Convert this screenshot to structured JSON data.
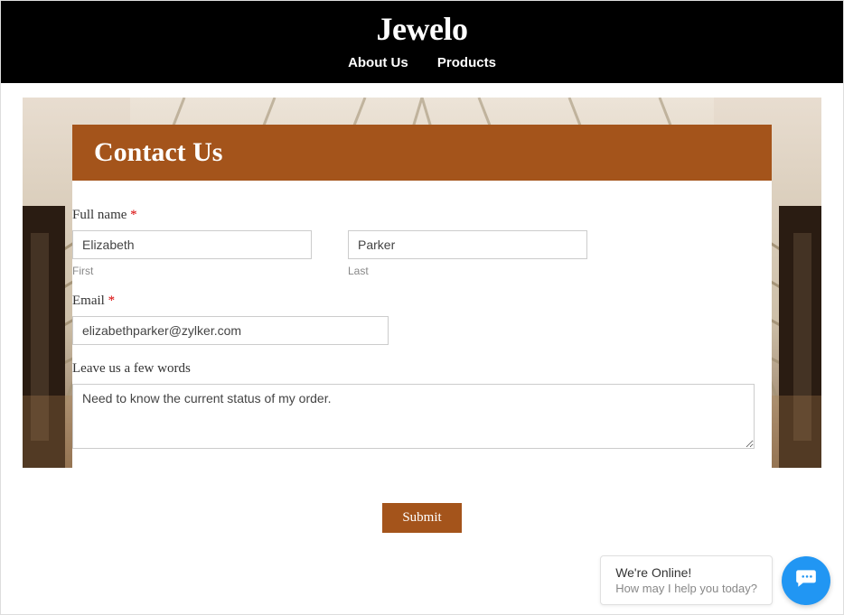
{
  "header": {
    "brand": "Jewelo",
    "nav": {
      "about": "About Us",
      "products": "Products"
    }
  },
  "form": {
    "title": "Contact Us",
    "fullname_label": "Full name",
    "required_mark": "*",
    "first_value": "Elizabeth",
    "first_sublabel": "First",
    "last_value": "Parker",
    "last_sublabel": "Last",
    "email_label": "Email",
    "email_value": "elizabethparker@zylker.com",
    "message_label": "Leave us a few words",
    "message_value": "Need to know the current status of my order.",
    "submit_label": "Submit"
  },
  "chat": {
    "title": "We're Online!",
    "subtitle": "How may I help you today?"
  },
  "colors": {
    "brand_brown": "#a4541b",
    "chat_blue": "#2196f3"
  }
}
